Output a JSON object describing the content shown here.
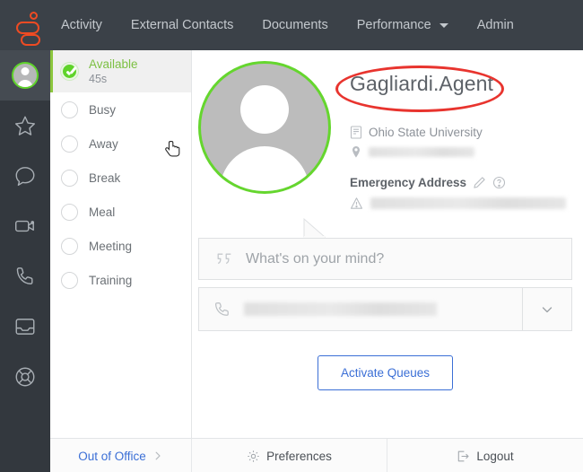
{
  "topnav": {
    "logo_name": "genesys-logo",
    "links": [
      {
        "label": "Activity",
        "has_caret": false
      },
      {
        "label": "External Contacts",
        "has_caret": false
      },
      {
        "label": "Documents",
        "has_caret": false
      },
      {
        "label": "Performance",
        "has_caret": true
      },
      {
        "label": "Admin",
        "has_caret": false
      }
    ]
  },
  "rail": {
    "items": [
      {
        "name": "profile-avatar",
        "icon": "avatar-icon",
        "active": true
      },
      {
        "name": "favorites",
        "icon": "star-icon",
        "active": false
      },
      {
        "name": "chat",
        "icon": "chat-bubble-icon",
        "active": false
      },
      {
        "name": "video",
        "icon": "video-camera-icon",
        "active": false
      },
      {
        "name": "calls",
        "icon": "phone-icon",
        "active": false
      },
      {
        "name": "inbox",
        "icon": "inbox-icon",
        "active": false
      },
      {
        "name": "help",
        "icon": "lifebuoy-icon",
        "active": false
      }
    ]
  },
  "status_panel": {
    "items": [
      {
        "label": "Available",
        "sub": "45s",
        "selected": true
      },
      {
        "label": "Busy",
        "sub": "",
        "selected": false
      },
      {
        "label": "Away",
        "sub": "",
        "selected": false
      },
      {
        "label": "Break",
        "sub": "",
        "selected": false
      },
      {
        "label": "Meal",
        "sub": "",
        "selected": false
      },
      {
        "label": "Meeting",
        "sub": "",
        "selected": false
      },
      {
        "label": "Training",
        "sub": "",
        "selected": false
      }
    ],
    "selected_color": "#7cc043"
  },
  "profile": {
    "name": "Gagliardi.Agent",
    "department": "Ohio State University",
    "location_redacted": true,
    "emergency_address_label": "Emergency Address",
    "emergency_address_redacted": true,
    "avatar_ring_color": "#65d62e",
    "annotation": {
      "shape": "ellipse",
      "color": "#e8342e",
      "targets": "profile-name"
    }
  },
  "status_update": {
    "placeholder": "What's on your mind?",
    "value": ""
  },
  "phone": {
    "value_redacted": true,
    "dropdown_icon": "chevron-down-icon"
  },
  "actions": {
    "activate_queues_label": "Activate Queues",
    "activate_queues_color": "#3b6fd6"
  },
  "footer": {
    "out_of_office_label": "Out of Office",
    "preferences_label": "Preferences",
    "logout_label": "Logout",
    "out_of_office_color": "#3b6fd6"
  }
}
